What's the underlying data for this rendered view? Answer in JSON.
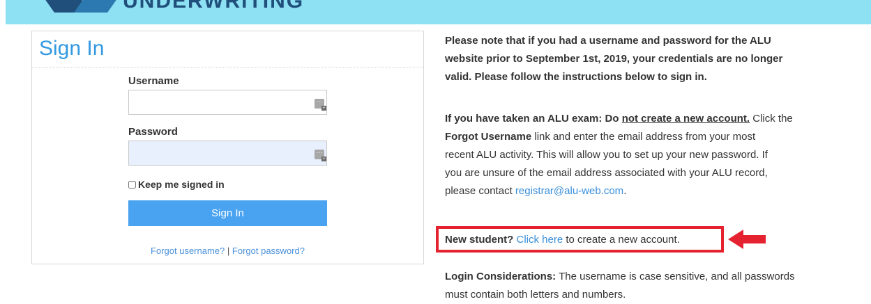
{
  "header": {
    "logo_text": "UNDERWRITING",
    "bg_color": "#8ee0f3"
  },
  "signin": {
    "title": "Sign In",
    "username_label": "Username",
    "username_value": "",
    "password_label": "Password",
    "password_value": "",
    "keep_signed_in_label": "Keep me signed in",
    "keep_signed_in_checked": false,
    "button_label": "Sign In",
    "forgot_username": "Forgot username?",
    "separator": "|",
    "forgot_password": "Forgot password?",
    "icons": {
      "password_manager": "password-manager-icon"
    },
    "accent_color": "#4aa3f0"
  },
  "info": {
    "note_lines": [
      "Please note that if you had a username and password for the ALU",
      "website prior to September 1st, 2019, your credentials are no longer",
      "valid. Please follow the instructions below to sign in."
    ],
    "exam": {
      "lead": "If you have taken an ALU exam: Do ",
      "underlined": "not create a new account.",
      "after_underline": " Click the",
      "forgot_bold": "Forgot Username",
      "line2_rest": " link and enter the email address from your most",
      "line3": "recent ALU activity. This will allow you to set up your new password. If",
      "line4": "you are unsure of the email address associated with your ALU record,",
      "line5_pre": "please contact ",
      "email": "registrar@alu-web.com",
      "line5_post": "."
    },
    "new_student": {
      "lead": "New student?",
      "link": "Click here",
      "rest": " to create a new account."
    },
    "login": {
      "lead": "Login Considerations:",
      "line1_rest": " The username is case sensitive, and all passwords",
      "line2": "must contain both letters and numbers."
    },
    "highlight_color": "#e52230",
    "link_color": "#3b8fdb"
  }
}
